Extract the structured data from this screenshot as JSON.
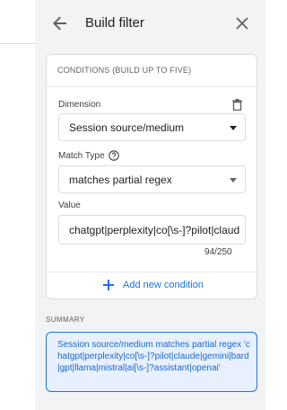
{
  "panel": {
    "title": "Build filter"
  },
  "conditions": {
    "header": "CONDITIONS (BUILD UP TO FIVE)",
    "dimension": {
      "label": "Dimension",
      "value": "Session source/medium"
    },
    "match_type": {
      "label": "Match Type",
      "value": "matches partial regex"
    },
    "value_field": {
      "label": "Value",
      "value": "chatgpt|perplexity|co[\\s-]?pilot|claud",
      "counter": "94/250"
    },
    "add_label": "Add new condition"
  },
  "summary": {
    "label": "SUMMARY",
    "text": "Session source/medium matches partial regex 'chatgpt|perplexity|co[\\s-]?pilot|claude|gemini|bard|gpt|llama|mistral|ai[\\s-]?assistant|openai'"
  },
  "colors": {
    "accent": "#1a73e8",
    "summary_bg": "#e8f0fe",
    "panel_bg": "#f1f3f4"
  },
  "icons": {
    "back": "arrow-back-icon",
    "close": "close-icon",
    "delete": "trash-icon",
    "help": "help-circle-icon",
    "add": "plus-icon"
  }
}
